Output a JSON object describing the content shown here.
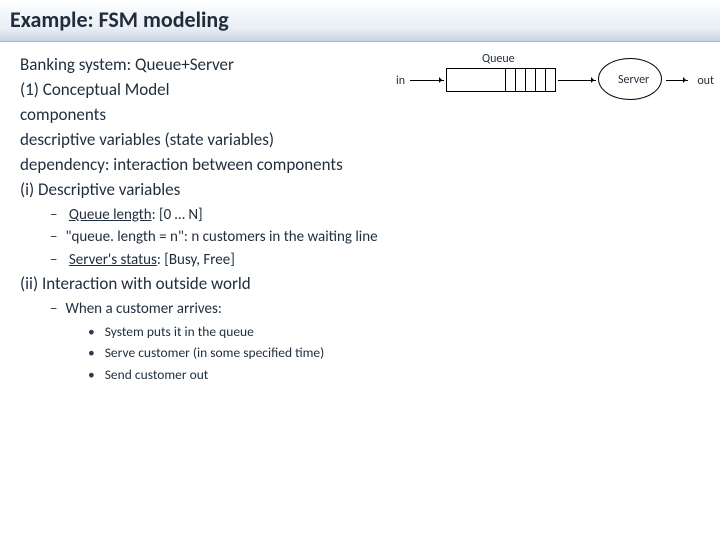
{
  "title": "Example: FSM modeling",
  "lines": {
    "l1": "Banking system: Queue+Server",
    "l2": "(1) Conceptual Model",
    "l3": "components",
    "l4": "descriptive variables (state variables)",
    "l5": "dependency: interaction between components",
    "l6": "(i) Descriptive variables",
    "b1a": "Queue length",
    "b1b": ": [0 … N]",
    "b2": "\"queue. length = n\":  n customers in the waiting line",
    "b3a": "Server's status",
    "b3b": ": [Busy, Free]",
    "l7": "(ii) Interaction with outside world",
    "b4": "When a customer arrives:",
    "c1": "System puts it in the queue",
    "c2": "Serve customer (in some specified time)",
    "c3": "Send customer out"
  },
  "diagram": {
    "in": "in",
    "out": "out",
    "queue": "Queue",
    "server": "Server"
  }
}
